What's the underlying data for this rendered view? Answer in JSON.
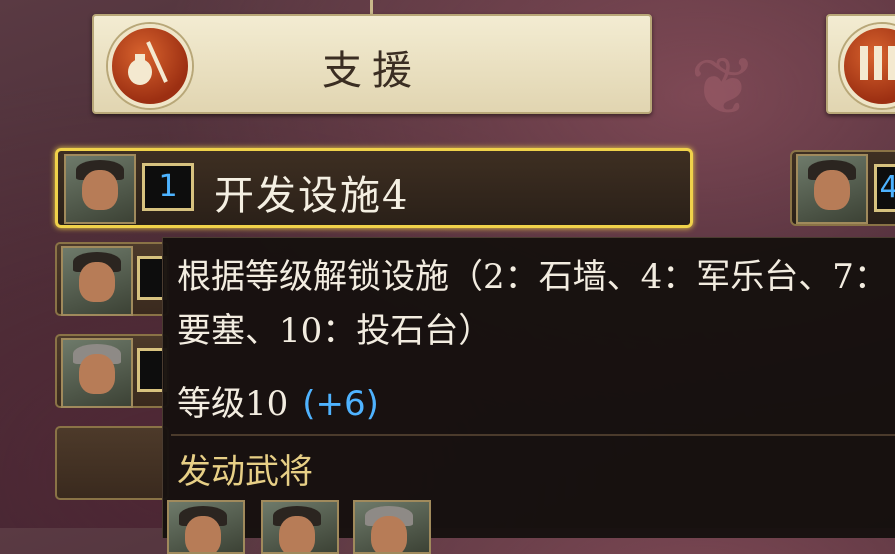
{
  "tabs": {
    "main_title": "支援"
  },
  "selected_row": {
    "number": "1",
    "skill_name": "开发设施4"
  },
  "side_row": {
    "number": "4"
  },
  "tooltip": {
    "description": "根据等级解锁设施（2：石墙、4：军乐台、7：要塞、10：投石台）",
    "level_label": "等级10",
    "level_bonus": "(+6)",
    "section_title": "发动武将"
  },
  "colors": {
    "highlight_border": "#f0d24a",
    "number_blue": "#4db3ff",
    "section_gold": "#e7cf86"
  }
}
